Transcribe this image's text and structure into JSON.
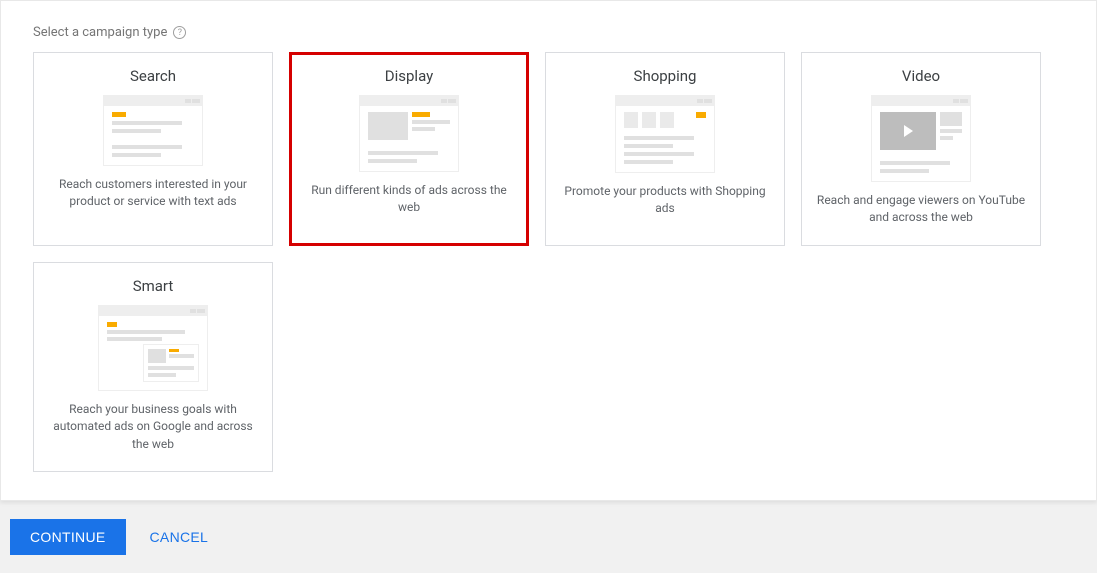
{
  "section_title": "Select a campaign type",
  "cards": {
    "search": {
      "title": "Search",
      "desc": "Reach customers interested in your product or service with text ads"
    },
    "display": {
      "title": "Display",
      "desc": "Run different kinds of ads across the web",
      "selected": true
    },
    "shopping": {
      "title": "Shopping",
      "desc": "Promote your products with Shopping ads"
    },
    "video": {
      "title": "Video",
      "desc": "Reach and engage viewers on YouTube and across the web"
    },
    "smart": {
      "title": "Smart",
      "desc": "Reach your business goals with automated ads on Google and across the web"
    }
  },
  "footer": {
    "continue": "CONTINUE",
    "cancel": "CANCEL"
  }
}
